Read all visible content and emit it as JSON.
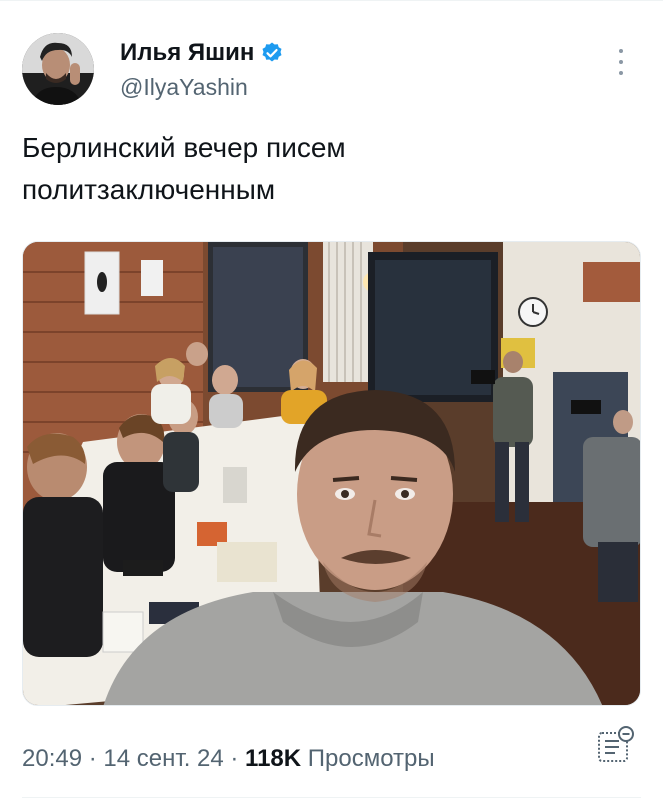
{
  "author": {
    "display_name": "Илья Яшин",
    "handle": "@IlyaYashin",
    "verified_icon": "verified-badge-icon",
    "avatar_icon": "avatar"
  },
  "tweet": {
    "text": "Берлинский вечер писем\nполитзаключенным"
  },
  "media": {
    "description_icon": "photo"
  },
  "meta": {
    "time": "20:49",
    "separator1": " · ",
    "date": "14 сент. 24",
    "separator2": " · ",
    "views_count": "118K",
    "views_label": " Просмотры"
  },
  "colors": {
    "verified_blue": "#1d9bf0",
    "text_primary": "#0f1419",
    "text_secondary": "#536471"
  },
  "icons": {
    "more": "more-vertical-icon",
    "analytics": "analytics-icon"
  }
}
